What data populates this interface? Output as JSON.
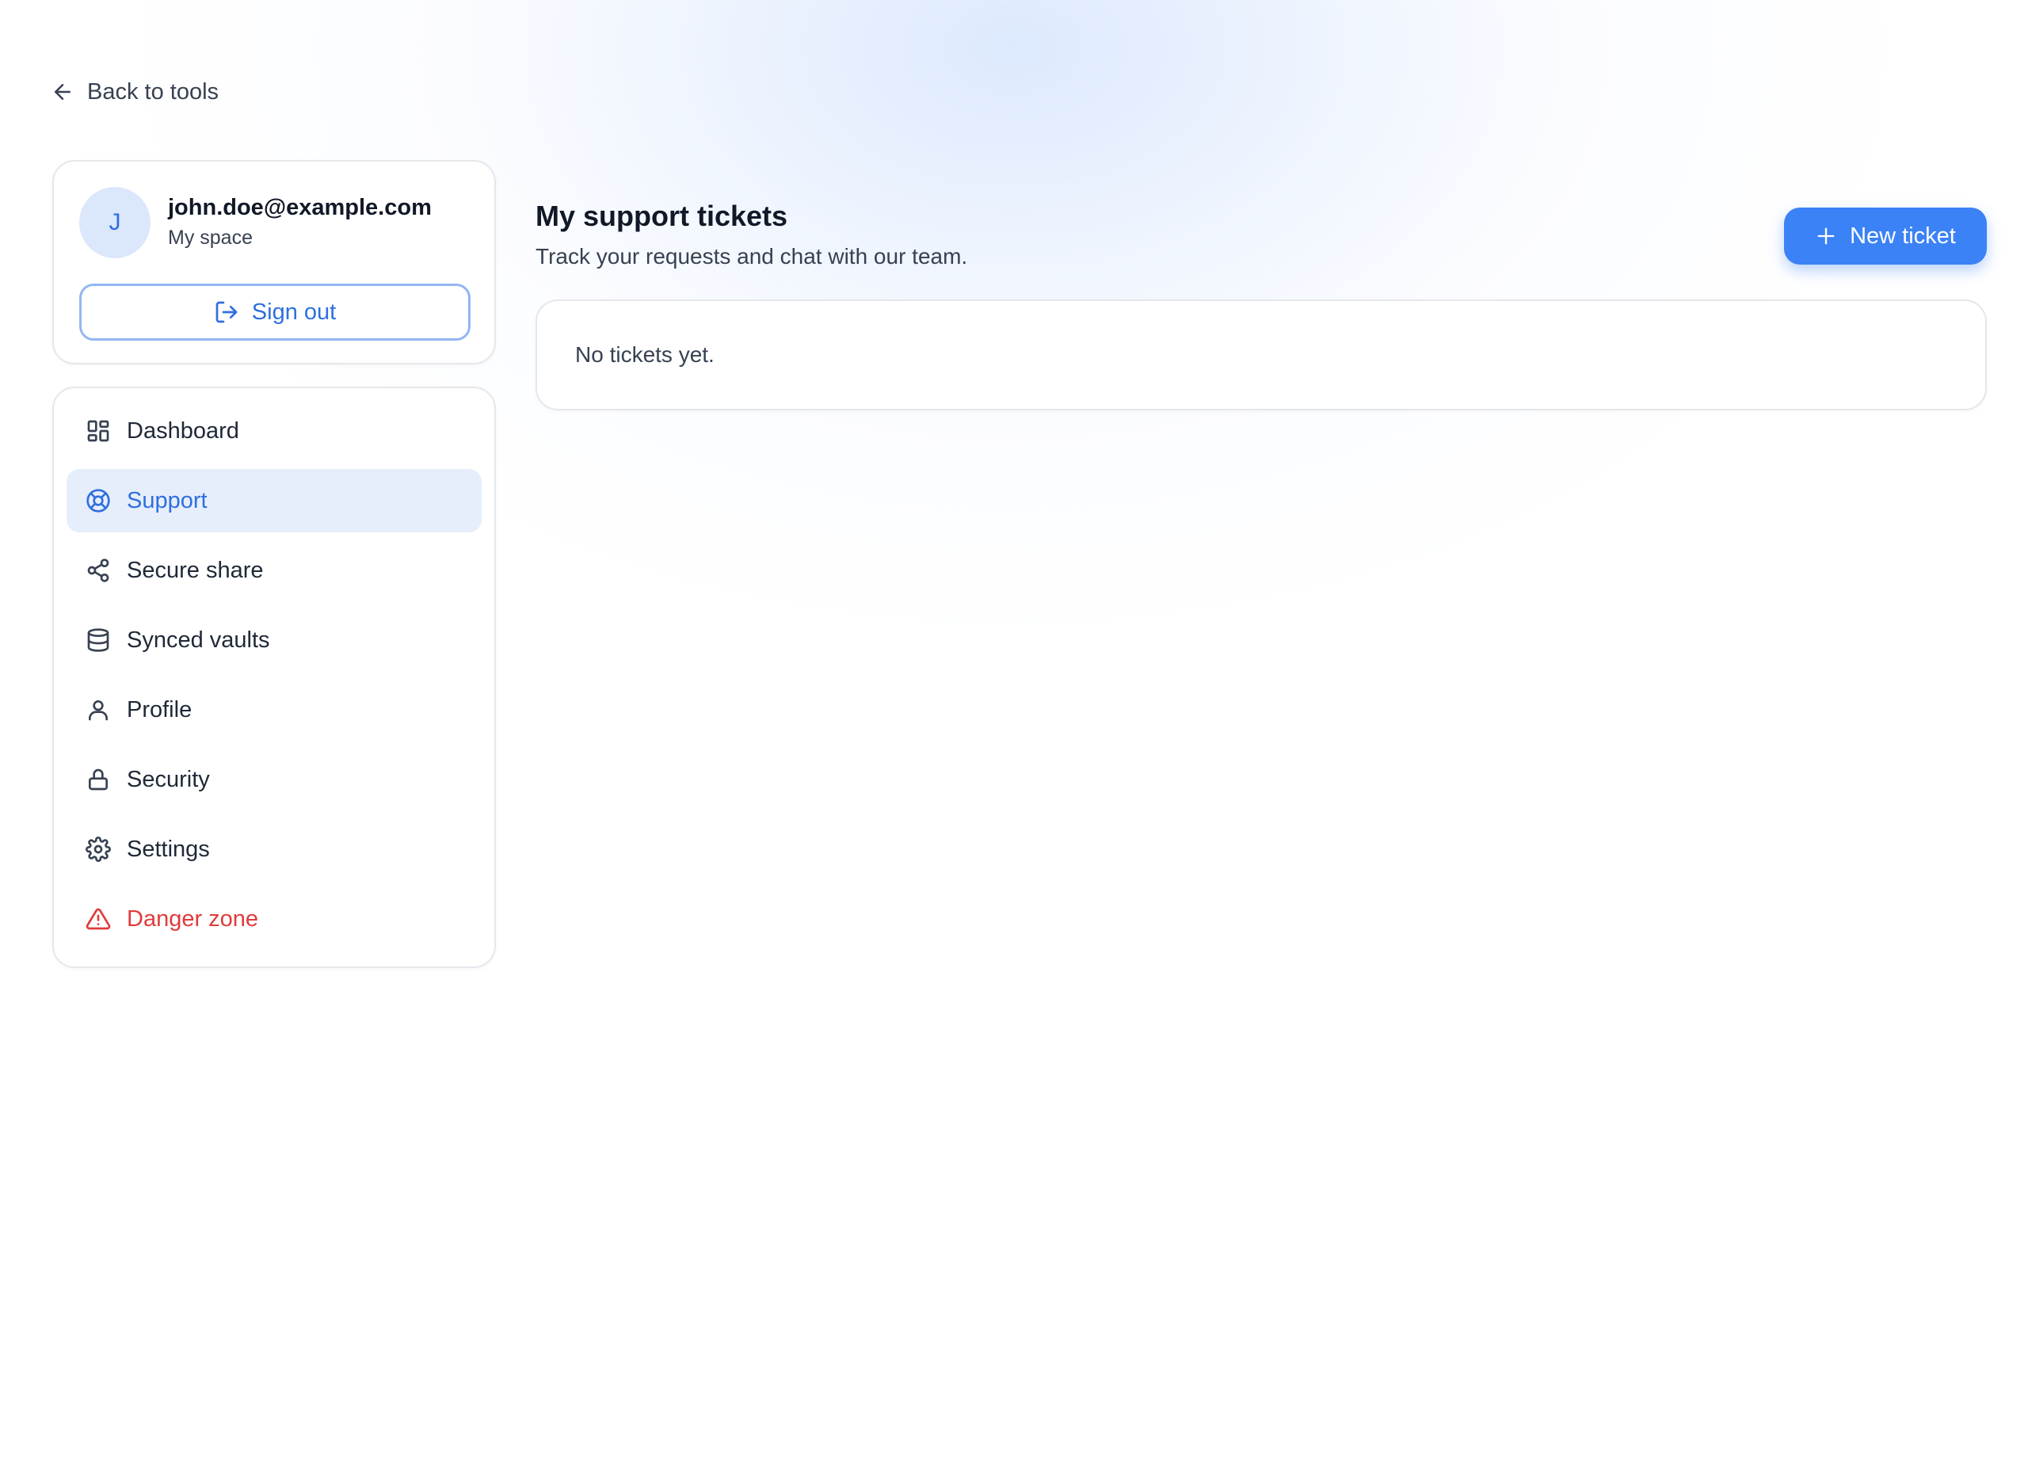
{
  "back_link": {
    "label": "Back to tools",
    "icon": "arrow-left-icon"
  },
  "user": {
    "avatar_initial": "J",
    "email": "john.doe@example.com",
    "space_label": "My space",
    "sign_out_label": "Sign out"
  },
  "nav": {
    "items": [
      {
        "label": "Dashboard",
        "icon": "dashboard-icon",
        "active": false
      },
      {
        "label": "Support",
        "icon": "lifebuoy-icon",
        "active": true
      },
      {
        "label": "Secure share",
        "icon": "share-icon",
        "active": false
      },
      {
        "label": "Synced vaults",
        "icon": "database-icon",
        "active": false
      },
      {
        "label": "Profile",
        "icon": "user-icon",
        "active": false
      },
      {
        "label": "Security",
        "icon": "lock-icon",
        "active": false
      },
      {
        "label": "Settings",
        "icon": "gear-icon",
        "active": false
      },
      {
        "label": "Danger zone",
        "icon": "warning-triangle-icon",
        "active": false
      }
    ]
  },
  "main": {
    "title": "My support tickets",
    "subtitle": "Track your requests and chat with our team.",
    "new_ticket_label": "New ticket",
    "empty_text": "No tickets yet."
  },
  "colors": {
    "accent": "#3b82f6",
    "accent_text": "#2f6fde",
    "active_bg": "#e6eefc",
    "danger": "#e03b3b"
  }
}
